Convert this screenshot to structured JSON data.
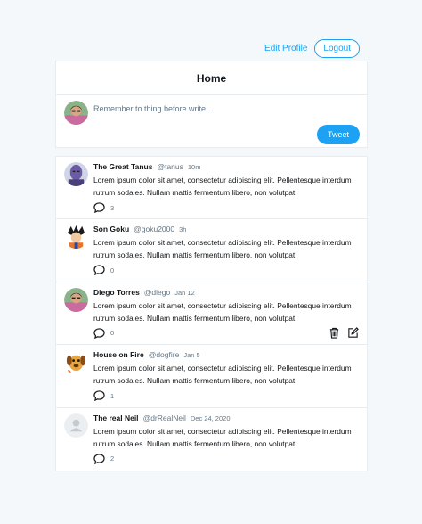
{
  "header": {
    "edit_profile_label": "Edit Profile",
    "logout_label": "Logout"
  },
  "home": {
    "title": "Home",
    "composer_placeholder": "Remember to thing before write...",
    "tweet_button_label": "Tweet"
  },
  "colors": {
    "accent": "#1da1f2",
    "page_bg": "#f5f8fa",
    "muted_text": "#657786"
  },
  "tweets": [
    {
      "name": "The Great Tanus",
      "handle": "@tanus",
      "time": "10m",
      "body": "Lorem ipsum dolor sit amet, consectetur adipiscing elit. Pellentesque interdum rutrum sodales. Nullam mattis fermentum libero, non volutpat.",
      "replies": "3",
      "avatar": "purple-character-avatar"
    },
    {
      "name": "Son Goku",
      "handle": "@goku2000",
      "time": "3h",
      "body": "Lorem ipsum dolor sit amet, consectetur adipiscing elit. Pellentesque interdum rutrum sodales. Nullam mattis fermentum libero, non volutpat.",
      "replies": "0",
      "avatar": "goku-avatar"
    },
    {
      "name": "Diego Torres",
      "handle": "@diego",
      "time": "Jan 12",
      "body": "Lorem ipsum dolor sit amet, consectetur adipiscing elit. Pellentesque interdum rutrum sodales. Nullam mattis fermentum libero, non volutpat.",
      "replies": "0",
      "avatar": "user-photo-avatar",
      "own": true
    },
    {
      "name": "House on Fire",
      "handle": "@dogfire",
      "time": "Jan 5",
      "body": "Lorem ipsum dolor sit amet, consectetur adipiscing elit. Pellentesque interdum rutrum sodales. Nullam mattis fermentum libero, non volutpat.",
      "replies": "1",
      "avatar": "dog-avatar"
    },
    {
      "name": "The real Neil",
      "handle": "@drRealNeil",
      "time": "Dec 24, 2020",
      "body": "Lorem ipsum dolor sit amet, consectetur adipiscing elit. Pellentesque interdum rutrum sodales. Nullam mattis fermentum libero, non volutpat.",
      "replies": "2",
      "avatar": "default-user-avatar"
    }
  ]
}
